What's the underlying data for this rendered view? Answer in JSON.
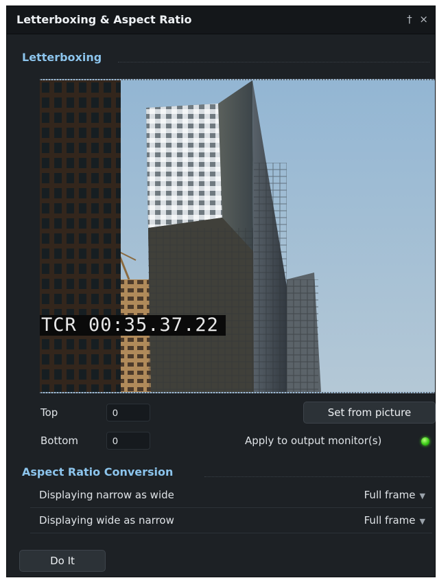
{
  "window": {
    "title": "Letterboxing & Aspect Ratio",
    "pin_icon": "pin-icon",
    "close_icon": "close-icon",
    "pin_glyph": "†",
    "close_glyph": "×"
  },
  "letterboxing": {
    "section_title": "Letterboxing",
    "timecode": "TCR 00:35.37.22",
    "top_label": "Top",
    "top_value": "0",
    "bottom_label": "Bottom",
    "bottom_value": "0",
    "set_from_picture_label": "Set from picture",
    "apply_label": "Apply to output monitor(s)",
    "apply_indicator_color": "#3ccd19"
  },
  "aspect_ratio": {
    "section_title": "Aspect Ratio Conversion",
    "rows": [
      {
        "label": "Displaying narrow as wide",
        "value": "Full frame"
      },
      {
        "label": "Displaying wide as narrow",
        "value": "Full frame"
      }
    ]
  },
  "actions": {
    "do_it_label": "Do It"
  },
  "colors": {
    "panel_bg": "#1d2125",
    "section_header": "#8cc4ec",
    "accent_green": "#3ccd19"
  }
}
